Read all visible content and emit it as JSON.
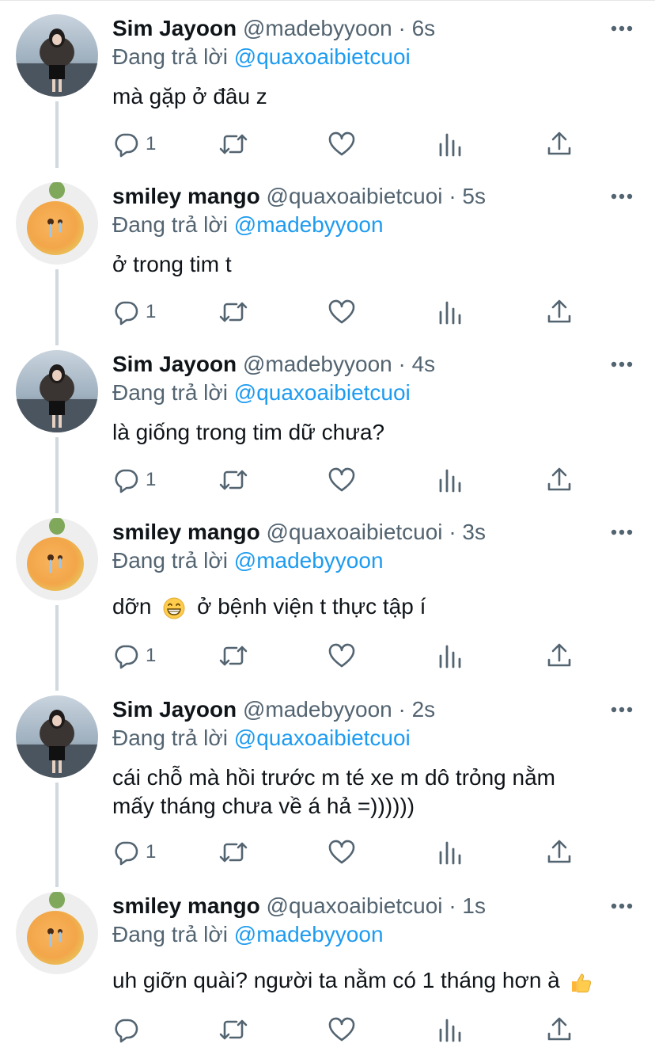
{
  "tweets": [
    {
      "author": "sim",
      "name": "Sim Jayoon",
      "handle": "@madebyyoon",
      "time": "6s",
      "reply_prefix": "Đang trả lời",
      "reply_to": "@quaxoaibietcuoi",
      "text": "mà gặp ở đâu z",
      "reply_count": "1"
    },
    {
      "author": "mango",
      "name": "smiley mango",
      "handle": "@quaxoaibietcuoi",
      "time": "5s",
      "reply_prefix": "Đang trả lời",
      "reply_to": "@madebyyoon",
      "text": "ở trong tim t",
      "reply_count": "1"
    },
    {
      "author": "sim",
      "name": "Sim Jayoon",
      "handle": "@madebyyoon",
      "time": "4s",
      "reply_prefix": "Đang trả lời",
      "reply_to": "@quaxoaibietcuoi",
      "text": "là giống trong tim dữ chưa?",
      "reply_count": "1"
    },
    {
      "author": "mango",
      "name": "smiley mango",
      "handle": "@quaxoaibietcuoi",
      "time": "3s",
      "reply_prefix": "Đang trả lời",
      "reply_to": "@madebyyoon",
      "text_before_emoji": "dỡn",
      "emoji": "grinning-face-emoji",
      "text_after_emoji": "ở bệnh viện t thực tập í",
      "reply_count": "1"
    },
    {
      "author": "sim",
      "name": "Sim Jayoon",
      "handle": "@madebyyoon",
      "time": "2s",
      "reply_prefix": "Đang trả lời",
      "reply_to": "@quaxoaibietcuoi",
      "text_line1": "cái chỗ mà hồi trước m té xe m dô trỏng nằm",
      "text_line2": "mấy tháng chưa về á hả =))))))",
      "reply_count": "1"
    },
    {
      "author": "mango",
      "name": "smiley mango",
      "handle": "@quaxoaibietcuoi",
      "time": "1s",
      "reply_prefix": "Đang trả lời",
      "reply_to": "@madebyyoon",
      "text": "uh giỡn quài? người ta nằm có 1 tháng hơn à",
      "emoji": "thumbs-up-emoji",
      "reply_count": ""
    }
  ],
  "separator": "·",
  "colors": {
    "text": "#0f1419",
    "secondary": "#536471",
    "link": "#1d9bf0",
    "thread_line": "#cfd9de"
  },
  "action_icons": [
    "reply-icon",
    "retweet-icon",
    "like-icon",
    "analytics-icon",
    "share-icon"
  ]
}
